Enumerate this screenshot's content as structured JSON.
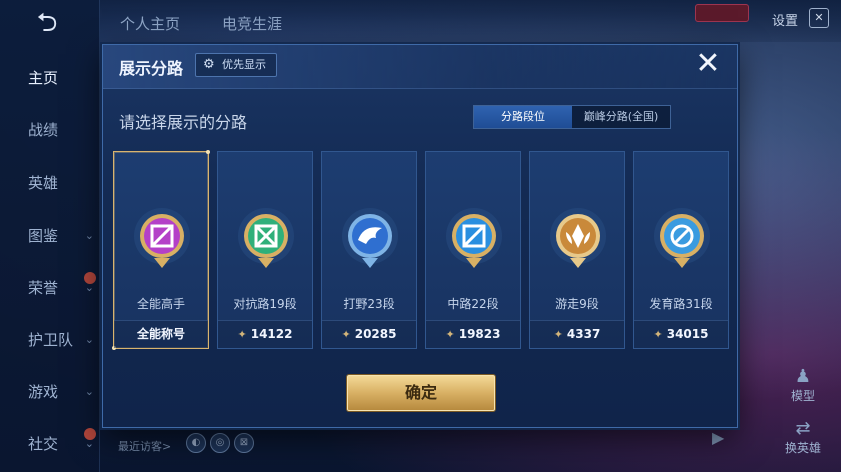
{
  "background": {
    "back_glyph": "⮌",
    "top_tabs": [
      "个人主页",
      "电竞生涯"
    ],
    "settings_label": "设置",
    "badge_text": "",
    "corner_glyph": "✕",
    "sidebar": {
      "items": [
        {
          "label": "主页",
          "active": true
        },
        {
          "label": "战绩"
        },
        {
          "label": "英雄"
        },
        {
          "label": "图鉴",
          "chevron": true
        },
        {
          "label": "荣誉",
          "chevron": true,
          "hot": true
        },
        {
          "label": "护卫队",
          "chevron": true
        },
        {
          "label": "游戏",
          "chevron": true
        },
        {
          "label": "社交",
          "chevron": true,
          "hot": true
        }
      ]
    },
    "recent_visitors_label": "最近访客>",
    "side_actions": [
      "模型",
      "换英雄"
    ]
  },
  "modal": {
    "title": "展示分路",
    "priority_label": "优先显示",
    "close_label": "✕",
    "hint": "请选择展示的分路",
    "tabs": [
      {
        "label": "分路段位",
        "active": true
      },
      {
        "label": "巅峰分路(全国)",
        "active": false
      }
    ],
    "cards": [
      {
        "name": "全能高手",
        "footer": "全能称号",
        "has_rank_icon": false,
        "selected": true,
        "emblem": "omni-role-icon",
        "color": "#b440c8"
      },
      {
        "name": "对抗路19段",
        "footer": "14122",
        "has_rank_icon": true,
        "selected": false,
        "emblem": "clash-lane-icon",
        "color": "#2fb07a"
      },
      {
        "name": "打野23段",
        "footer": "20285",
        "has_rank_icon": true,
        "selected": false,
        "emblem": "jungle-icon",
        "color": "#2f6fd0"
      },
      {
        "name": "中路22段",
        "footer": "19823",
        "has_rank_icon": true,
        "selected": false,
        "emblem": "mid-lane-icon",
        "color": "#2a8fe0"
      },
      {
        "name": "游走9段",
        "footer": "4337",
        "has_rank_icon": true,
        "selected": false,
        "emblem": "roam-icon",
        "color": "#c9893a"
      },
      {
        "name": "发育路31段",
        "footer": "34015",
        "has_rank_icon": true,
        "selected": false,
        "emblem": "farm-lane-icon",
        "color": "#3a9be0"
      }
    ],
    "confirm_label": "确定",
    "colors": {
      "accent_gold": "#d8b064",
      "panel_blue": "#1a3563",
      "tab_active": "#2f63b0"
    }
  }
}
